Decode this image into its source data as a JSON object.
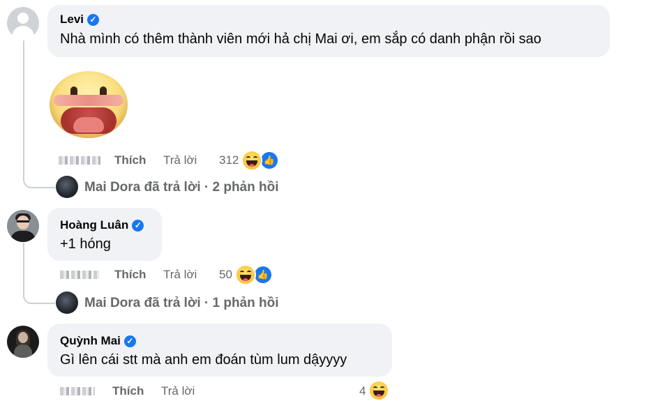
{
  "comments": [
    {
      "name": "Levi",
      "text": "Nhà mình có thêm thành viên mới hả chị Mai ơi, em sắp có danh phận rồi sao",
      "like_label": "Thích",
      "reply_label": "Trả lời",
      "reaction_count": "312",
      "reactions": [
        "haha-icon",
        "like-icon"
      ],
      "reply_summary": "Mai Dora đã trả lời · 2 phản hồi"
    },
    {
      "name": "Hoàng Luân",
      "text": "+1 hóng",
      "like_label": "Thích",
      "reply_label": "Trả lời",
      "reaction_count": "50",
      "reactions": [
        "haha-icon",
        "like-icon"
      ],
      "reply_summary": "Mai Dora đã trả lời · 1 phản hồi"
    },
    {
      "name": "Quỳnh Mai",
      "text": "Gì lên cái stt mà anh em đoán tùm lum dậyyyy",
      "like_label": "Thích",
      "reply_label": "Trả lời",
      "reaction_count": "4",
      "reactions": [
        "haha-icon"
      ]
    }
  ],
  "colors": {
    "bubble": "#f0f2f5",
    "secondary_text": "#65676b",
    "verified": "#1877f2",
    "thread_line": "#ccd0d5"
  }
}
